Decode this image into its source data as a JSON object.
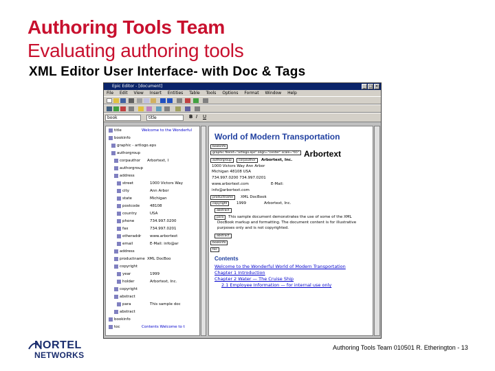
{
  "slide": {
    "title_line1": "Authoring Tools Team",
    "title_line2": "Evaluating authoring tools",
    "subtitle": "XML Editor User Interface- with Doc & Tags",
    "footer": "Authoring Tools Team 010501  R.  Etherington   - 13",
    "brand_line1": "NORTEL",
    "brand_line2": "NETWORKS"
  },
  "editor": {
    "window_title": "Epic Editor - [document]",
    "menu": [
      "File",
      "Edit",
      "View",
      "Insert",
      "Entities",
      "Table",
      "Tools",
      "Options",
      "Format",
      "Window",
      "Help"
    ],
    "element_combo": "book",
    "title_combo": "title",
    "tree": [
      {
        "name": "title",
        "value": "Welcome to the Wonderful",
        "blue": true
      },
      {
        "name": "bookinfo",
        "value": ""
      },
      {
        "name": "graphic - artlogo.eps",
        "value": ""
      },
      {
        "name": "authorgroup",
        "value": ""
      },
      {
        "name": "corpauthor",
        "value": "Arbortext, I"
      },
      {
        "name": "authorgroup",
        "value": ""
      },
      {
        "name": "address",
        "value": ""
      },
      {
        "name": "street",
        "value": "1000 Victors Way"
      },
      {
        "name": "city",
        "value": "Ann Arbor"
      },
      {
        "name": "state",
        "value": "Michigan"
      },
      {
        "name": "postcode",
        "value": "48108"
      },
      {
        "name": "country",
        "value": "USA"
      },
      {
        "name": "phone",
        "value": "734.997.0200"
      },
      {
        "name": "fax",
        "value": "734.997.0201"
      },
      {
        "name": "otheraddr",
        "value": "www.arbortext"
      },
      {
        "name": "email",
        "value": "E-Mail: info@ar"
      },
      {
        "name": "address",
        "value": ""
      },
      {
        "name": "productname",
        "value": "XML DocBoo"
      },
      {
        "name": "copyright",
        "value": ""
      },
      {
        "name": "year",
        "value": "1999"
      },
      {
        "name": "holder",
        "value": "Arbortext, Inc."
      },
      {
        "name": "copyright",
        "value": ""
      },
      {
        "name": "abstract",
        "value": ""
      },
      {
        "name": "para",
        "value": "This sample doc"
      },
      {
        "name": "abstract",
        "value": ""
      },
      {
        "name": "bookinfo",
        "value": ""
      },
      {
        "name": "toc",
        "value": "Contents Welcome to t",
        "blue": true
      }
    ],
    "doc_title": "World of Modern Transportation",
    "company": "Arbortext",
    "graphic_tag": "graphic fileref=\"artlogo.eps\" align=\"center\" scale=\"65\"",
    "address_line": "1000 Victors Way   Ann Arbor",
    "state_line": "Michigan   48108   USA",
    "phone_line": "734.997.0200   734.997.0201",
    "web_line": "www.arbortext.com",
    "email_line": "E-Mail:",
    "email_addr": "info@arbortext.com",
    "product_line": "XML DocBook",
    "year_line": "1999",
    "holder_line": "Arbortext, Inc.",
    "para_line1": "This sample document demonstrates the use of some of the XML",
    "para_line2": "DocBook markup and formatting. The document content is for illustrative",
    "para_line3": "purposes only and is not copyrighted.",
    "contents_title": "Contents",
    "toc": [
      "Welcome to the Wonderful World of Modern Transportation",
      "Chapter 1 Introduction",
      "Chapter 2 Water — The Cruise Ship",
      "2.1   Employee Information — for internal use only"
    ]
  }
}
